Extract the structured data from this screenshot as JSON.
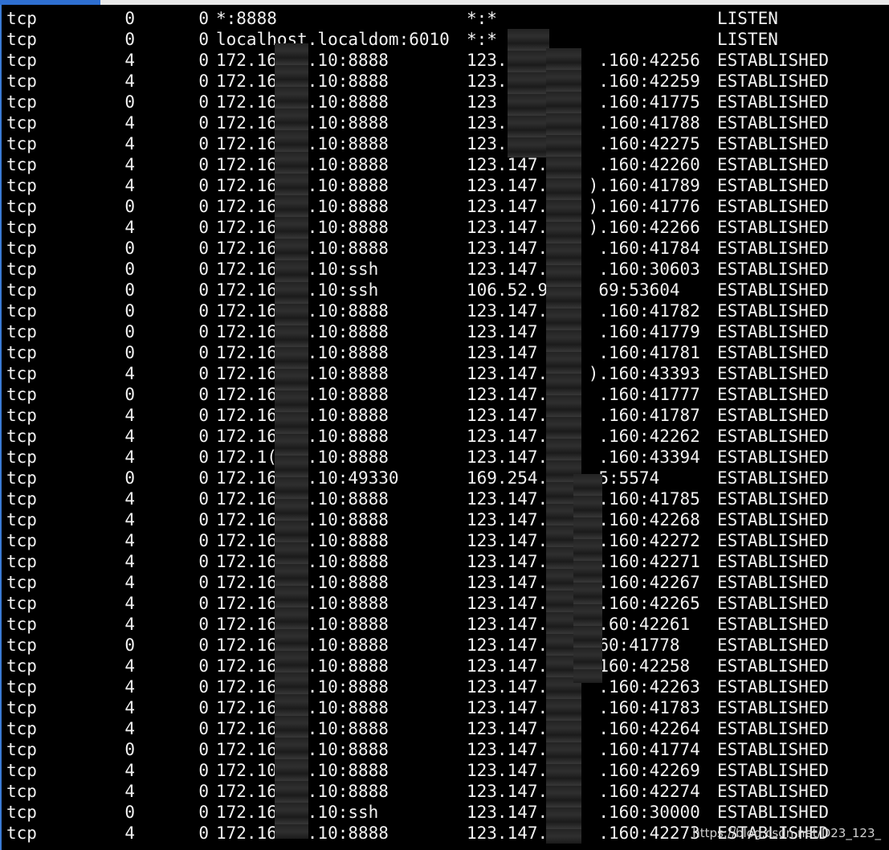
{
  "terminal": {
    "rows": [
      {
        "proto": "tcp",
        "recvq": "0",
        "sendq": "0",
        "local": "*:8888",
        "foreign": "*:*",
        "state": "LISTEN"
      },
      {
        "proto": "tcp",
        "recvq": "0",
        "sendq": "0",
        "local": "localhost.localdom:6010",
        "foreign": "*:*",
        "state": "LISTEN"
      },
      {
        "proto": "tcp",
        "recvq": "4",
        "sendq": "0",
        "local": "172.16   .10:8888",
        "foreign": "123.         .160:42256",
        "state": "ESTABLISHED"
      },
      {
        "proto": "tcp",
        "recvq": "4",
        "sendq": "0",
        "local": "172.16   .10:8888",
        "foreign": "123.         .160:42259",
        "state": "ESTABLISHED"
      },
      {
        "proto": "tcp",
        "recvq": "0",
        "sendq": "0",
        "local": "172.16   .10:8888",
        "foreign": "123          .160:41775",
        "state": "ESTABLISHED"
      },
      {
        "proto": "tcp",
        "recvq": "4",
        "sendq": "0",
        "local": "172.16   .10:8888",
        "foreign": "123.1        .160:41788",
        "state": "ESTABLISHED"
      },
      {
        "proto": "tcp",
        "recvq": "4",
        "sendq": "0",
        "local": "172.16   .10:8888",
        "foreign": "123.1        .160:42275",
        "state": "ESTABLISHED"
      },
      {
        "proto": "tcp",
        "recvq": "4",
        "sendq": "0",
        "local": "172.16   .10:8888",
        "foreign": "123.147.     .160:42260",
        "state": "ESTABLISHED"
      },
      {
        "proto": "tcp",
        "recvq": "4",
        "sendq": "0",
        "local": "172.16   .10:8888",
        "foreign": "123.147.    ).160:41789",
        "state": "ESTABLISHED"
      },
      {
        "proto": "tcp",
        "recvq": "0",
        "sendq": "0",
        "local": "172.16   .10:8888",
        "foreign": "123.147.    ).160:41776",
        "state": "ESTABLISHED"
      },
      {
        "proto": "tcp",
        "recvq": "4",
        "sendq": "0",
        "local": "172.16   .10:8888",
        "foreign": "123.147.    ).160:42266",
        "state": "ESTABLISHED"
      },
      {
        "proto": "tcp",
        "recvq": "0",
        "sendq": "0",
        "local": "172.16   .10:8888",
        "foreign": "123.147.     .160:41784",
        "state": "ESTABLISHED"
      },
      {
        "proto": "tcp",
        "recvq": "0",
        "sendq": "0",
        "local": "172.16   .10:ssh",
        "foreign": "123.147.     .160:30603",
        "state": "ESTABLISHED"
      },
      {
        "proto": "tcp",
        "recvq": "0",
        "sendq": "0",
        "local": "172.16   .10:ssh",
        "foreign": "106.52.9     69:53604",
        "state": "ESTABLISHED"
      },
      {
        "proto": "tcp",
        "recvq": "0",
        "sendq": "0",
        "local": "172.16   .10:8888",
        "foreign": "123.147.     .160:41782",
        "state": "ESTABLISHED"
      },
      {
        "proto": "tcp",
        "recvq": "0",
        "sendq": "0",
        "local": "172.16   .10:8888",
        "foreign": "123.147      .160:41779",
        "state": "ESTABLISHED"
      },
      {
        "proto": "tcp",
        "recvq": "0",
        "sendq": "0",
        "local": "172.16   .10:8888",
        "foreign": "123.147      .160:41781",
        "state": "ESTABLISHED"
      },
      {
        "proto": "tcp",
        "recvq": "4",
        "sendq": "0",
        "local": "172.16   .10:8888",
        "foreign": "123.147.    ).160:43393",
        "state": "ESTABLISHED"
      },
      {
        "proto": "tcp",
        "recvq": "0",
        "sendq": "0",
        "local": "172.16   .10:8888",
        "foreign": "123.147.     .160:41777",
        "state": "ESTABLISHED"
      },
      {
        "proto": "tcp",
        "recvq": "4",
        "sendq": "0",
        "local": "172.16   .10:8888",
        "foreign": "123.147.1    .160:41787",
        "state": "ESTABLISHED"
      },
      {
        "proto": "tcp",
        "recvq": "4",
        "sendq": "0",
        "local": "172.16   .10:8888",
        "foreign": "123.147.     .160:42262",
        "state": "ESTABLISHED"
      },
      {
        "proto": "tcp",
        "recvq": "4",
        "sendq": "0",
        "local": "172.1(   .10:8888",
        "foreign": "123.147.     .160:43394",
        "state": "ESTABLISHED"
      },
      {
        "proto": "tcp",
        "recvq": "0",
        "sendq": "0",
        "local": "172.16   .10:49330",
        "foreign": "169.254.     5:5574",
        "state": "ESTABLISHED"
      },
      {
        "proto": "tcp",
        "recvq": "4",
        "sendq": "0",
        "local": "172.16   .10:8888",
        "foreign": "123.147.     .160:41785",
        "state": "ESTABLISHED"
      },
      {
        "proto": "tcp",
        "recvq": "4",
        "sendq": "0",
        "local": "172.16   .10:8888",
        "foreign": "123.147.     .160:42268",
        "state": "ESTABLISHED"
      },
      {
        "proto": "tcp",
        "recvq": "4",
        "sendq": "0",
        "local": "172.16   .10:8888",
        "foreign": "123.147.2    .160:42272",
        "state": "ESTABLISHED"
      },
      {
        "proto": "tcp",
        "recvq": "4",
        "sendq": "0",
        "local": "172.16   .10:8888",
        "foreign": "123.147.     .160:42271",
        "state": "ESTABLISHED"
      },
      {
        "proto": "tcp",
        "recvq": "4",
        "sendq": "0",
        "local": "172.16   .10:8888",
        "foreign": "123.147.     .160:42267",
        "state": "ESTABLISHED"
      },
      {
        "proto": "tcp",
        "recvq": "4",
        "sendq": "0",
        "local": "172.16   .10:8888",
        "foreign": "123.147.     .160:42265",
        "state": "ESTABLISHED"
      },
      {
        "proto": "tcp",
        "recvq": "4",
        "sendq": "0",
        "local": "172.16   .10:8888",
        "foreign": "123.147.     .60:42261",
        "state": "ESTABLISHED"
      },
      {
        "proto": "tcp",
        "recvq": "0",
        "sendq": "0",
        "local": "172.16   .10:8888",
        "foreign": "123.147.    )60:41778",
        "state": "ESTABLISHED"
      },
      {
        "proto": "tcp",
        "recvq": "4",
        "sendq": "0",
        "local": "172.16   .10:8888",
        "foreign": "123.147.     160:42258",
        "state": "ESTABLISHED"
      },
      {
        "proto": "tcp",
        "recvq": "4",
        "sendq": "0",
        "local": "172.16   .10:8888",
        "foreign": "123.147.     .160:42263",
        "state": "ESTABLISHED"
      },
      {
        "proto": "tcp",
        "recvq": "4",
        "sendq": "0",
        "local": "172.16   .10:8888",
        "foreign": "123.147.     .160:41783",
        "state": "ESTABLISHED"
      },
      {
        "proto": "tcp",
        "recvq": "4",
        "sendq": "0",
        "local": "172.16   .10:8888",
        "foreign": "123.147.     .160:42264",
        "state": "ESTABLISHED"
      },
      {
        "proto": "tcp",
        "recvq": "0",
        "sendq": "0",
        "local": "172.16   .10:8888",
        "foreign": "123.147.     .160:41774",
        "state": "ESTABLISHED"
      },
      {
        "proto": "tcp",
        "recvq": "4",
        "sendq": "0",
        "local": "172.10  ).10:8888",
        "foreign": "123.147.     .160:42269",
        "state": "ESTABLISHED"
      },
      {
        "proto": "tcp",
        "recvq": "4",
        "sendq": "0",
        "local": "172.16   .10:8888",
        "foreign": "123.147.     .160:42274",
        "state": "ESTABLISHED"
      },
      {
        "proto": "tcp",
        "recvq": "0",
        "sendq": "0",
        "local": "172.16   .10:ssh",
        "foreign": "123.147.     .160:30000",
        "state": "ESTABLISHED"
      },
      {
        "proto": "tcp",
        "recvq": "4",
        "sendq": "0",
        "local": "172.16   .10:8888",
        "foreign": "123.147.     .160:42273",
        "state": "ESTABLISHED"
      }
    ]
  },
  "watermark": {
    "text": "https://blog.csdn.net/D23_123_"
  },
  "colors": {
    "background": "#000000",
    "text": "#f2f2f2",
    "accent": "#2e6fd1"
  }
}
